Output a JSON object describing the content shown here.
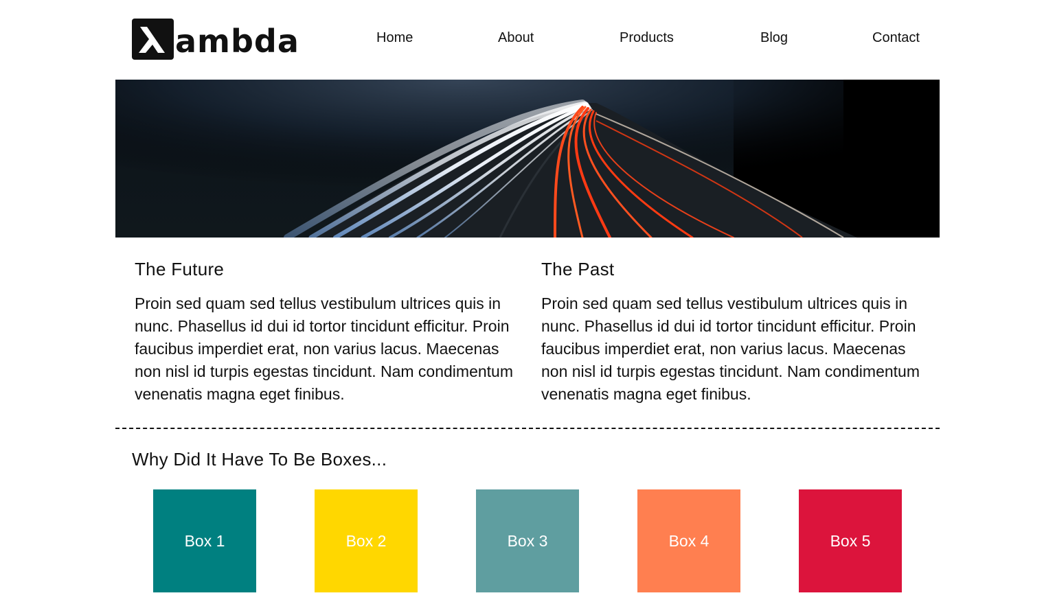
{
  "logo": {
    "icon": "lambda-icon",
    "text": "ambda"
  },
  "nav": {
    "items": [
      {
        "label": "Home"
      },
      {
        "label": "About"
      },
      {
        "label": "Products"
      },
      {
        "label": "Blog"
      },
      {
        "label": "Contact"
      }
    ]
  },
  "hero": {
    "image": "highway-light-trails-night"
  },
  "sections": [
    {
      "title": "The Future",
      "body": "Proin sed quam sed tellus vestibulum ultrices quis in nunc. Phasellus id dui id tortor tincidunt efficitur. Proin faucibus imperdiet erat, non varius lacus. Maecenas non nisl id turpis egestas tincidunt. Nam condimentum venenatis magna eget finibus."
    },
    {
      "title": "The Past",
      "body": "Proin sed quam sed tellus vestibulum ultrices quis in nunc. Phasellus id dui id tortor tincidunt efficitur. Proin faucibus imperdiet erat, non varius lacus. Maecenas non nisl id turpis egestas tincidunt. Nam condimentum venenatis magna eget finibus."
    }
  ],
  "boxes_section": {
    "title": "Why Did It Have To Be Boxes..."
  },
  "boxes": [
    {
      "label": "Box 1",
      "color": "#008080"
    },
    {
      "label": "Box 2",
      "color": "#FFD700"
    },
    {
      "label": "Box 3",
      "color": "#5F9EA0"
    },
    {
      "label": "Box 4",
      "color": "#FF7F50"
    },
    {
      "label": "Box 5",
      "color": "#DC143C"
    }
  ]
}
